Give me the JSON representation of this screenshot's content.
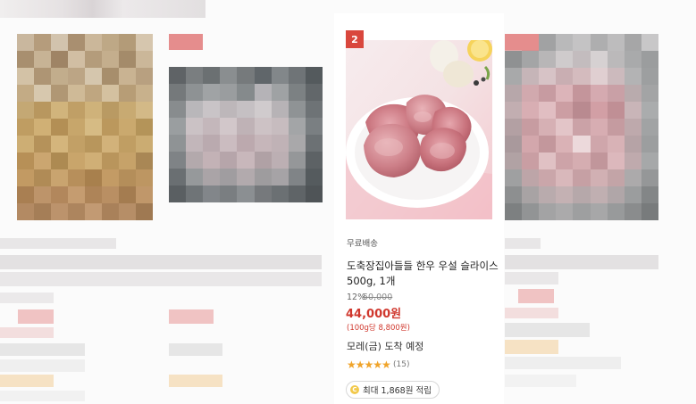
{
  "product": {
    "rank": "2",
    "shipping_badge": "무료배송",
    "title_line1": "도축장집아들들 한우 우설 슬라이스",
    "title_line2": "500g, 1개",
    "discount_rate": "12%",
    "original_price": "50,000",
    "sale_price": "44,000원",
    "unit_price": "(100g당 8,800원)",
    "delivery": "모레(금) 도착 예정",
    "rating_stars": "★★★★★",
    "review_count": "(15)",
    "reward_text": "최대 1,868원 적립",
    "reward_icon": "coin-icon"
  },
  "colors": {
    "accent_red": "#d0382e",
    "rank_badge": "#d9473d",
    "star": "#f0a42a"
  }
}
